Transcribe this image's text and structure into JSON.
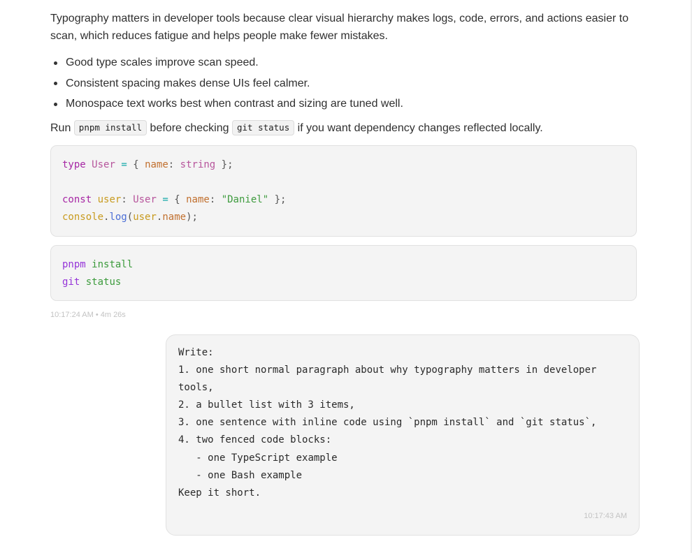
{
  "assistant": {
    "paragraph": "Typography matters in developer tools because clear visual hierarchy makes logs, code, errors, and actions easier to scan, which reduces fatigue and helps people make fewer mistakes.",
    "bullets": [
      "Good type scales improve scan speed.",
      "Consistent spacing makes dense UIs feel calmer.",
      "Monospace text works best when contrast and sizing are tuned well."
    ],
    "inline_sentence": {
      "part1": "Run ",
      "code1": "pnpm install",
      "part2": " before checking ",
      "code2": "git status",
      "part3": " if you want dependency changes reflected locally."
    },
    "ts_code": {
      "l1_kw": "type",
      "l1_type": "User",
      "l1_eq": "=",
      "l1_open": "{",
      "l1_prop": "name",
      "l1_colon": ":",
      "l1_ptype": "string",
      "l1_close": "};",
      "l3_kw": "const",
      "l3_var": "user",
      "l3_colon": ":",
      "l3_type": "User",
      "l3_eq": "=",
      "l3_open": "{",
      "l3_prop": "name",
      "l3_colon2": ":",
      "l3_str": "\"Daniel\"",
      "l3_close": "};",
      "l4_obj": "console",
      "l4_dot": ".",
      "l4_fn": "log",
      "l4_paren": "(",
      "l4_arg1": "user",
      "l4_dot2": ".",
      "l4_arg2": "name",
      "l4_close": ");"
    },
    "bash_code": {
      "l1_cmd": "pnpm",
      "l1_arg": "install",
      "l2_cmd": "git",
      "l2_arg": "status"
    },
    "meta": "10:17:24 AM • 4m 26s"
  },
  "user_message": {
    "text": "Write:\n1. one short normal paragraph about why typography matters in developer tools,\n2. a bullet list with 3 items,\n3. one sentence with inline code using `pnpm install` and `git status`,\n4. two fenced code blocks:\n   - one TypeScript example\n   - one Bash example\nKeep it short.",
    "time": "10:17:43 AM"
  }
}
